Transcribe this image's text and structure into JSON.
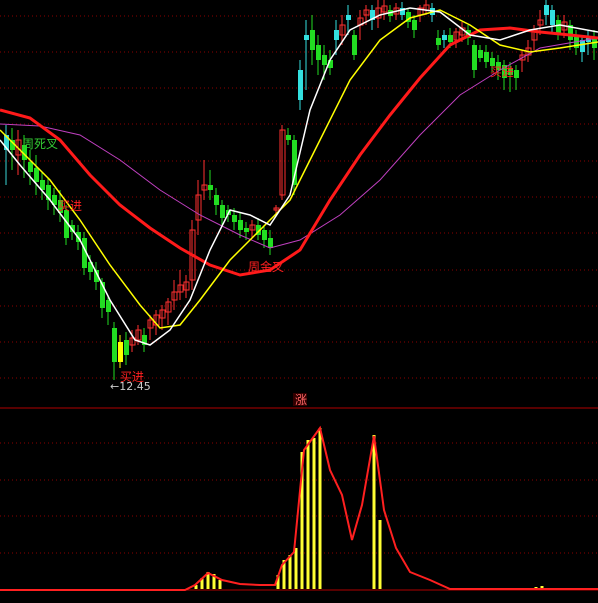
{
  "chart_data": [
    {
      "type": "candlestick",
      "panel": "price",
      "annotations": {
        "death_cross": "周死叉",
        "buy_1": "买进",
        "buy_2": "买进",
        "buy_3": "买进",
        "golden_cross": "周金叉",
        "low_marker": "←12.45"
      },
      "series_colors": {
        "ma_white": "#ffffff",
        "ma_yellow": "#ffff00",
        "ma_red": "#ff1a1a",
        "ma_magenta": "#cc33cc"
      }
    },
    {
      "type": "bar",
      "panel": "indicator",
      "marker": "涨",
      "bar_color": "#ffff33",
      "line_color": "#ff2020"
    }
  ]
}
